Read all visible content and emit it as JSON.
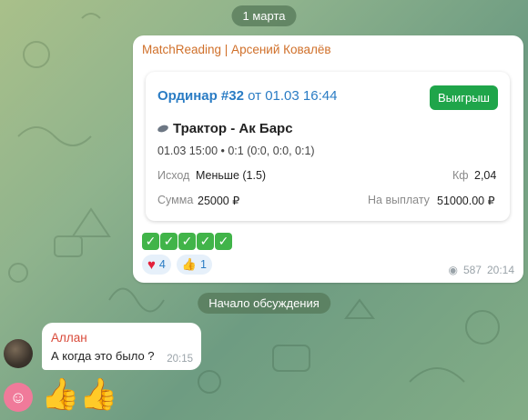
{
  "date_separator": "1 марта",
  "system_message": "Начало обсуждения",
  "post": {
    "author": "MatchReading | Арсений Ковалёв",
    "card": {
      "title_number": "Ординар #32",
      "title_date": "от 01.03 16:44",
      "badge": "Выигрыш",
      "match": "Трактор - Ак Барс",
      "info": "01.03 15:00 • 0:1 (0:0, 0:0, 0:1)",
      "outcome_label": "Исход",
      "outcome_value": "Меньше (1.5)",
      "odds_label": "Кф",
      "odds_value": "2,04",
      "stake_label": "Сумма",
      "stake_value": "25000 ₽",
      "payout_label": "На выплату",
      "payout_value": "51000.00 ₽"
    },
    "check_emojis": [
      "✓",
      "✓",
      "✓",
      "✓",
      "✓"
    ],
    "reactions": [
      {
        "icon": "heart",
        "count": "4"
      },
      {
        "icon": "thumbs-up",
        "count": "1"
      }
    ],
    "views": "587",
    "time": "20:14"
  },
  "reply": {
    "author": "Аллан",
    "text": "А когда это было ?",
    "time": "20:15"
  },
  "sticker": "👍👍"
}
